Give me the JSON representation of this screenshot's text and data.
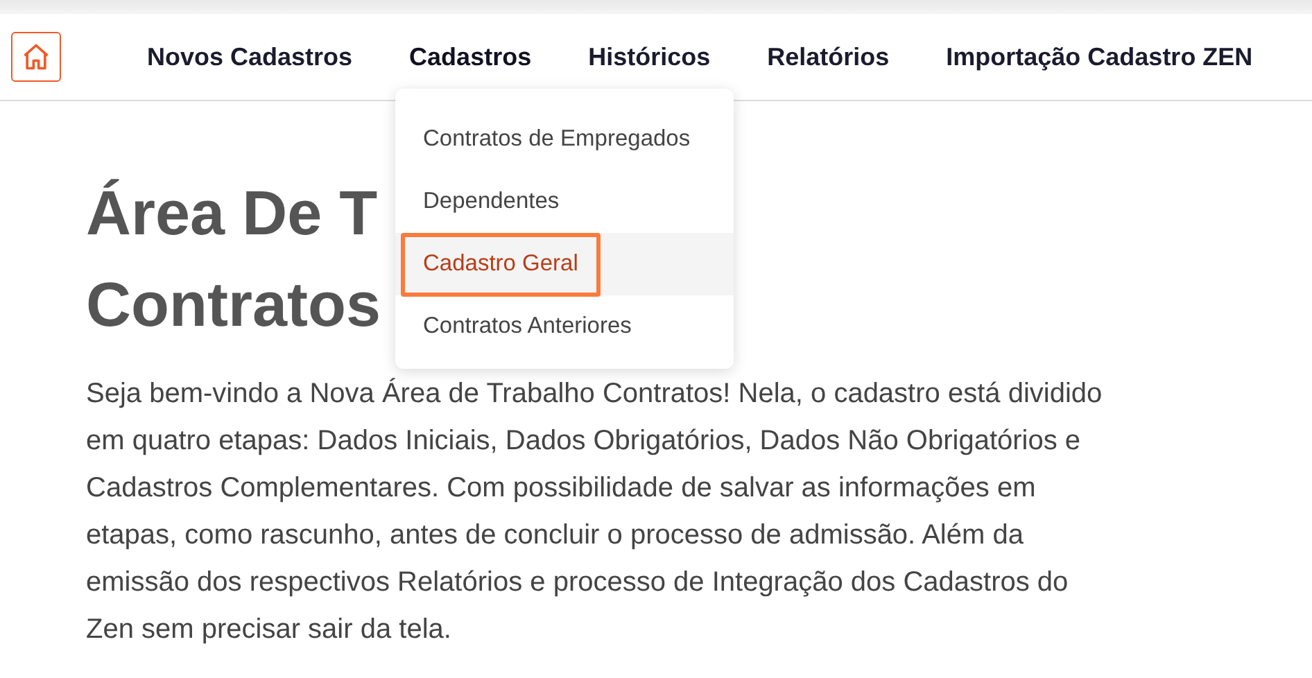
{
  "nav": {
    "items": [
      {
        "label": "Novos Cadastros",
        "expanded": false
      },
      {
        "label": "Cadastros",
        "expanded": true
      },
      {
        "label": "Históricos",
        "expanded": false
      },
      {
        "label": "Relatórios",
        "expanded": false
      },
      {
        "label": "Importação Cadastro ZEN",
        "expanded": false
      }
    ]
  },
  "dropdown": {
    "items": [
      {
        "label": "Contratos de Empregados",
        "selected": false
      },
      {
        "label": "Dependentes",
        "selected": false
      },
      {
        "label": "Cadastro Geral",
        "selected": true
      },
      {
        "label": "Contratos Anteriores",
        "selected": false
      }
    ]
  },
  "heading": [
    "Área De T",
    "Contratos"
  ],
  "intro": "Seja bem-vindo a Nova Área de Trabalho Contratos! Nela, o cadastro está dividido em quatro etapas: Dados Iniciais, Dados Obrigatórios, Dados Não Obrigatórios e Cadastros Complementares. Com possibilidade de salvar as informações em etapas, como rascunho, antes de concluir o processo de admissão. Além da emissão dos respectivos Relatórios e processo de Integração dos Cadastros do Zen sem precisar sair da tela."
}
